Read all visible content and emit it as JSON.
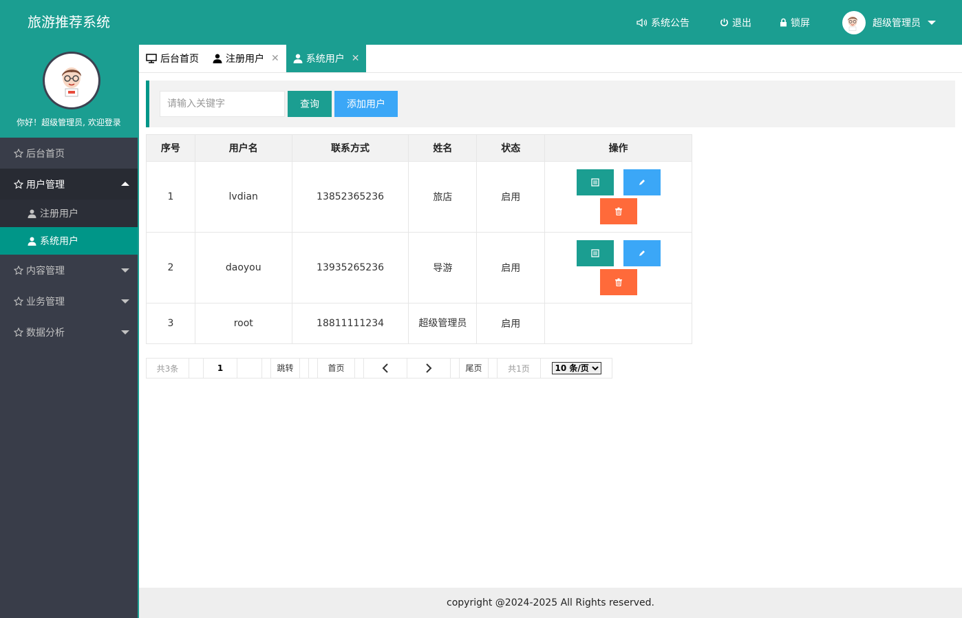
{
  "app": {
    "title": "旅游推荐系统"
  },
  "header": {
    "notice_label": "系统公告",
    "logout_label": "退出",
    "lock_label": "锁屏",
    "user_name": "超级管理员"
  },
  "sidebar": {
    "welcome": "你好！超级管理员, 欢迎登录",
    "items": [
      {
        "label": "后台首页"
      },
      {
        "label": "用户管理",
        "children": [
          {
            "label": "注册用户"
          },
          {
            "label": "系统用户"
          }
        ]
      },
      {
        "label": "内容管理"
      },
      {
        "label": "业务管理"
      },
      {
        "label": "数据分析"
      }
    ]
  },
  "tabs": [
    {
      "label": "后台首页"
    },
    {
      "label": "注册用户"
    },
    {
      "label": "系统用户"
    }
  ],
  "search": {
    "placeholder": "请输入关键字",
    "query_label": "查询",
    "add_label": "添加用户"
  },
  "table": {
    "headers": [
      "序号",
      "用户名",
      "联系方式",
      "姓名",
      "状态",
      "操作"
    ],
    "rows": [
      {
        "index": "1",
        "username": "lvdian",
        "phone": "13852365236",
        "name": "旅店",
        "status": "启用"
      },
      {
        "index": "2",
        "username": "daoyou",
        "phone": "13935265236",
        "name": "导游",
        "status": "启用"
      },
      {
        "index": "3",
        "username": "root",
        "phone": "18811111234",
        "name": "超级管理员",
        "status": "启用"
      }
    ]
  },
  "pagination": {
    "total": "共3条",
    "page": "1",
    "jump": "跳转",
    "first": "首页",
    "last": "尾页",
    "pages": "共1页",
    "page_size": "10 条/页"
  },
  "footer": {
    "text": "copyright @2024-2025 All Rights reserved."
  },
  "colors": {
    "primary": "#1b9e91",
    "blue": "#3ba7f7",
    "danger": "#ff6a3a",
    "sidebar": "#393d49"
  }
}
